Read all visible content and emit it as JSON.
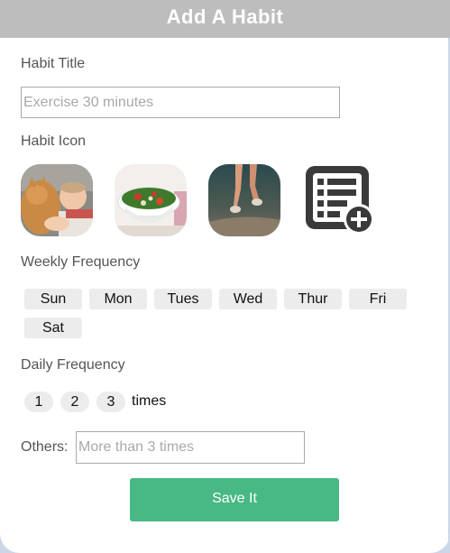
{
  "header": {
    "title": "Add A Habit"
  },
  "habit_title": {
    "label": "Habit Title",
    "placeholder": "Exercise 30 minutes",
    "value": ""
  },
  "habit_icon": {
    "label": "Habit Icon",
    "icons": [
      {
        "name": "cat-and-baby-photo-icon"
      },
      {
        "name": "salad-bowl-photo-icon"
      },
      {
        "name": "running-legs-photo-icon"
      },
      {
        "name": "add-list-icon"
      }
    ]
  },
  "weekly_frequency": {
    "label": "Weekly Frequency",
    "days": [
      "Sun",
      "Mon",
      "Tues",
      "Wed",
      "Thur",
      "Fri",
      "Sat"
    ]
  },
  "daily_frequency": {
    "label": "Daily Frequency",
    "options": [
      "1",
      "2",
      "3"
    ],
    "suffix": "times"
  },
  "others": {
    "label": "Others:",
    "placeholder": "More than 3 times",
    "value": ""
  },
  "save": {
    "label": "Save It"
  },
  "colors": {
    "header_bg": "#bdbdbd",
    "save_bg": "#48b985",
    "chip_bg": "#ececec"
  }
}
